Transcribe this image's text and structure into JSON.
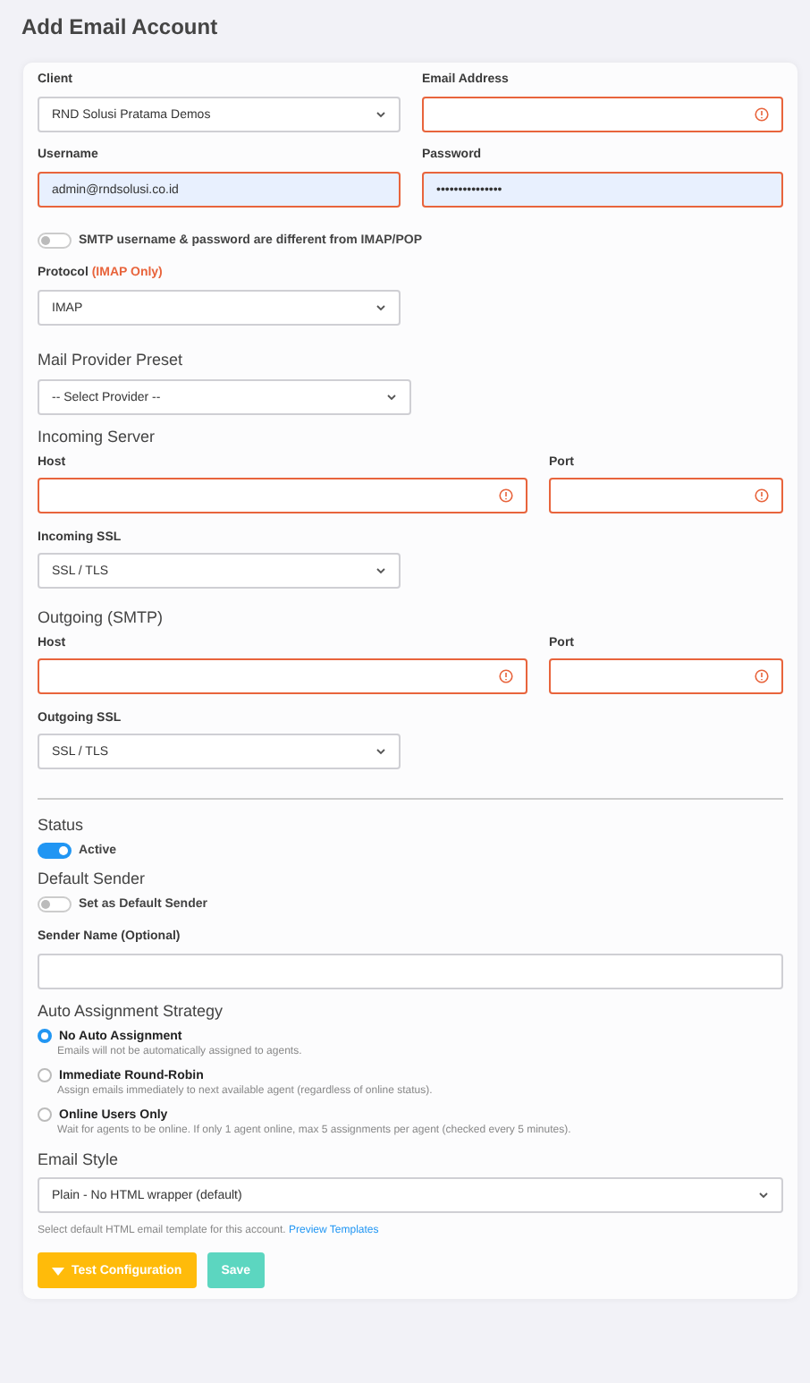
{
  "title": "Add Email Account",
  "account_fields": [
    {
      "label": "Client",
      "kind": "select",
      "value": "RND Solusi Pratama Demos",
      "error": false,
      "autofill": false
    },
    {
      "label": "Email Address",
      "kind": "input",
      "error": true,
      "autofill": false
    },
    {
      "label": "Username",
      "kind": "input",
      "value": "admin@rndsolusi.co.id",
      "error": true,
      "autofill": true
    },
    {
      "label": "Password",
      "kind": "input",
      "value": "•••••••••••••••",
      "error": true,
      "autofill": true
    }
  ],
  "smtp_credentials_toggle": {
    "label": "SMTP username & password are different from IMAP/POP",
    "on": false
  },
  "protocol": {
    "label": "Protocol",
    "note": "(IMAP Only)",
    "value": "IMAP"
  },
  "provider_preset": {
    "heading": "Mail Provider Preset",
    "value": "-- Select Provider --"
  },
  "servers": [
    {
      "heading": "Incoming Server",
      "host": {
        "label": "Host",
        "error": true
      },
      "port": {
        "label": "Port",
        "error": true
      },
      "ssl": {
        "label": "Incoming SSL",
        "value": "SSL / TLS"
      }
    },
    {
      "heading": "Outgoing (SMTP)",
      "host": {
        "label": "Host",
        "error": true
      },
      "port": {
        "label": "Port",
        "error": true
      },
      "ssl": {
        "label": "Outgoing SSL",
        "value": "SSL / TLS"
      }
    }
  ],
  "status": {
    "heading": "Status",
    "label": "Active",
    "on": true
  },
  "default_sender": {
    "heading": "Default Sender",
    "label": "Set as Default Sender",
    "on": false
  },
  "sender_name": {
    "label": "Sender Name (Optional)"
  },
  "auto_assignment": {
    "heading": "Auto Assignment Strategy",
    "options": [
      {
        "label": "No Auto Assignment",
        "description": "Emails will not be automatically assigned to agents.",
        "selected": true
      },
      {
        "label": "Immediate Round-Robin",
        "description": "Assign emails immediately to next available agent (regardless of online status).",
        "selected": false
      },
      {
        "label": "Online Users Only",
        "description": "Wait for agents to be online. If only 1 agent online, max 5 assignments per agent (checked every 5 minutes).",
        "selected": false
      }
    ]
  },
  "email_style": {
    "heading": "Email Style",
    "value": "Plain - No HTML wrapper (default)",
    "hint": "Select default HTML email template for this account.",
    "link": "Preview Templates"
  },
  "buttons": [
    {
      "label": "Test Configuration",
      "kind": "test"
    },
    {
      "label": "Save",
      "kind": "save"
    }
  ]
}
